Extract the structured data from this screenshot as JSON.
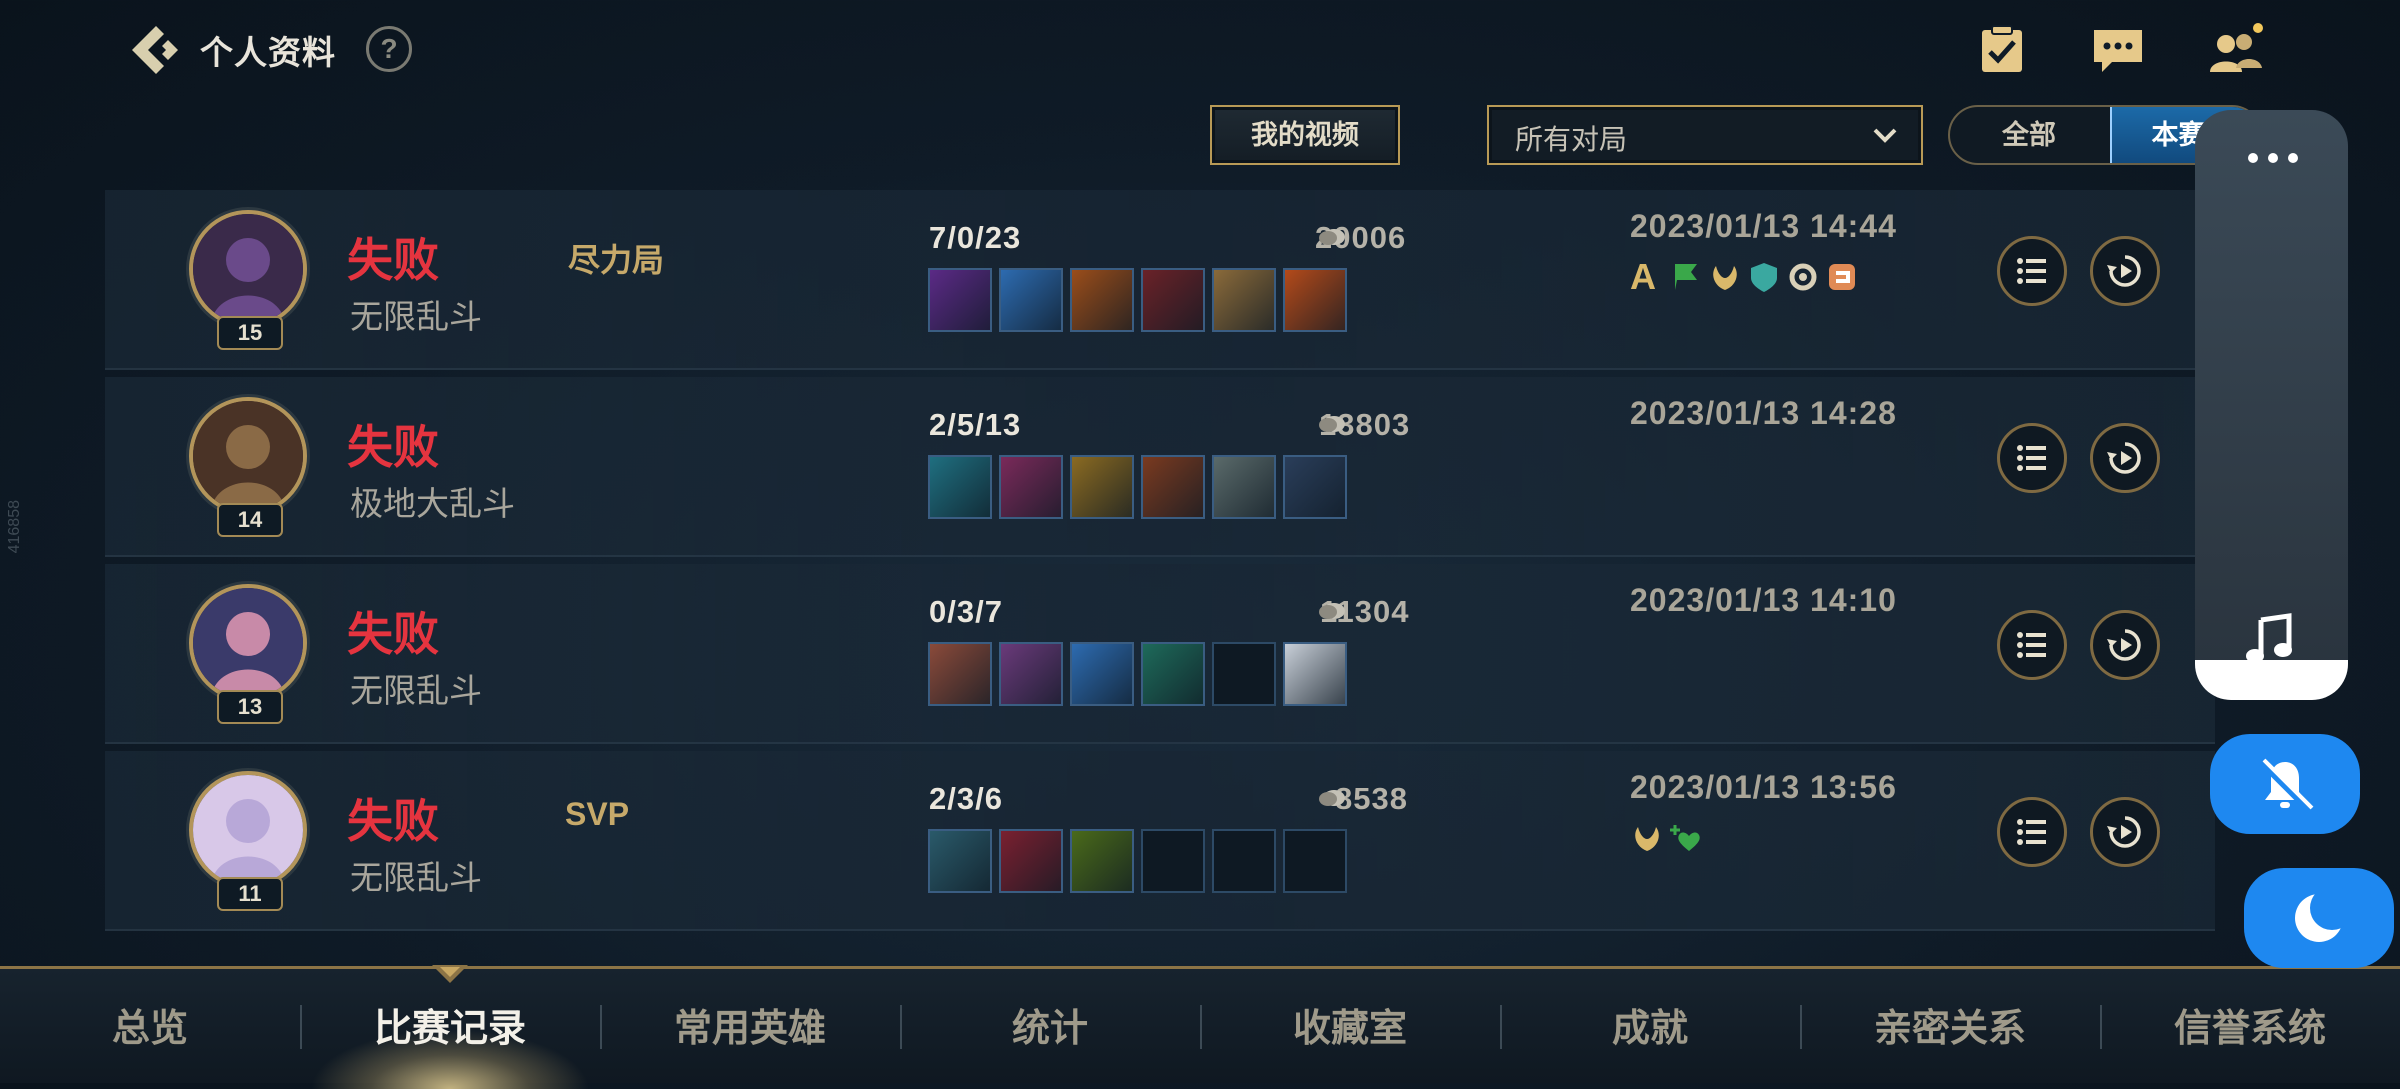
{
  "header": {
    "title": "个人资料",
    "help_label": "?"
  },
  "filters": {
    "video_button": "我的视频",
    "match_type_selected": "所有对局",
    "segment_all": "全部",
    "segment_season": "本赛季"
  },
  "matches": [
    {
      "level": "15",
      "result": "失败",
      "tag": "尽力局",
      "mode": "无限乱斗",
      "kda": "7/0/23",
      "gold": "20006",
      "datetime": "2023/01/13 14:44",
      "items": [
        "#5b2a86",
        "#2d6bb0",
        "#9a4d1a",
        "#6a2228",
        "#8a6a3a",
        "#b34a1a"
      ],
      "badges": [
        "A",
        "flag-icon",
        "wings-icon",
        "shield-icon",
        "gear-icon",
        "link-icon"
      ]
    },
    {
      "level": "14",
      "result": "失败",
      "tag": "",
      "mode": "极地大乱斗",
      "kda": "2/5/13",
      "gold": "13803",
      "datetime": "2023/01/13 14:28",
      "items": [
        "#1f6f80",
        "#7a2a5a",
        "#8a6a22",
        "#7a3a20",
        "#5a6a6a",
        "#2a3e5a"
      ],
      "badges": []
    },
    {
      "level": "13",
      "result": "失败",
      "tag": "",
      "mode": "无限乱斗",
      "kda": "0/3/7",
      "gold": "11304",
      "datetime": "2023/01/13 14:10",
      "items": [
        "#8a4a3a",
        "#6a3a7a",
        "#2d6bb0",
        "#1e6a5a",
        "",
        "#c8cfd8"
      ],
      "badges": []
    },
    {
      "level": "11",
      "result": "失败",
      "tag": "SVP",
      "mode": "无限乱斗",
      "kda": "2/3/6",
      "gold": "8538",
      "datetime": "2023/01/13 13:56",
      "items": [
        "#2a5a6a",
        "#7a2030",
        "#4a6a1a",
        "",
        "",
        ""
      ],
      "badges": [
        "wings-icon",
        "heart-plus-icon"
      ]
    }
  ],
  "nav": {
    "items": [
      "总览",
      "比赛记录",
      "常用英雄",
      "统计",
      "收藏室",
      "成就",
      "亲密关系",
      "信誉系统"
    ],
    "active_index": 1
  },
  "side_mark": "416858",
  "colors": {
    "defeat": "#e5343f",
    "gold_border": "#b89a56",
    "accent_blue": "#1e88f0"
  }
}
